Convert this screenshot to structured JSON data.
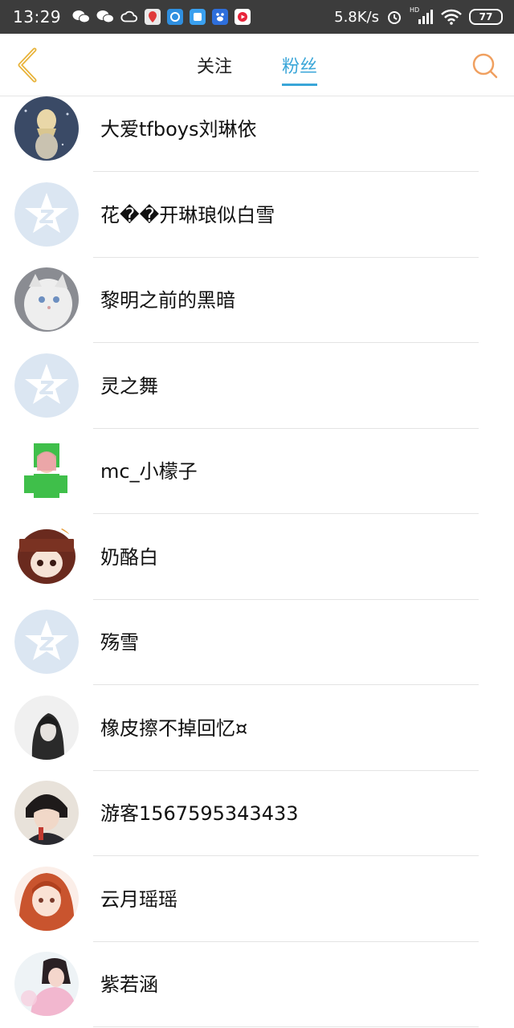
{
  "status_bar": {
    "time": "13:29",
    "net_speed": "5.8K/s",
    "network_label": "HD",
    "battery": "77"
  },
  "header": {
    "tabs": [
      {
        "label": "关注",
        "active": false
      },
      {
        "label": "粉丝",
        "active": true
      }
    ],
    "accent_color": "#3aa6d8",
    "back_icon_color": "#e8b33a",
    "search_icon_color": "#f0a060"
  },
  "followers": [
    {
      "name": "大爱tfboys刘琳依",
      "avatar": "photo-dark-blue"
    },
    {
      "name": "花��开琳琅似白雪",
      "avatar": "default-qzone-star"
    },
    {
      "name": "黎明之前的黑暗",
      "avatar": "photo-white-cat"
    },
    {
      "name": "灵之舞",
      "avatar": "default-qzone-star"
    },
    {
      "name": "mc_小檬子",
      "avatar": "photo-green-anime"
    },
    {
      "name": "奶酪白",
      "avatar": "photo-brown-anime"
    },
    {
      "name": "殇雪",
      "avatar": "default-qzone-star"
    },
    {
      "name": "橡皮擦不掉回忆¤",
      "avatar": "photo-dark-sketch"
    },
    {
      "name": "游客1567595343433",
      "avatar": "photo-dark-anime"
    },
    {
      "name": "云月瑶瑶",
      "avatar": "photo-red-anime"
    },
    {
      "name": "紫若涵",
      "avatar": "photo-pink-girl"
    }
  ]
}
